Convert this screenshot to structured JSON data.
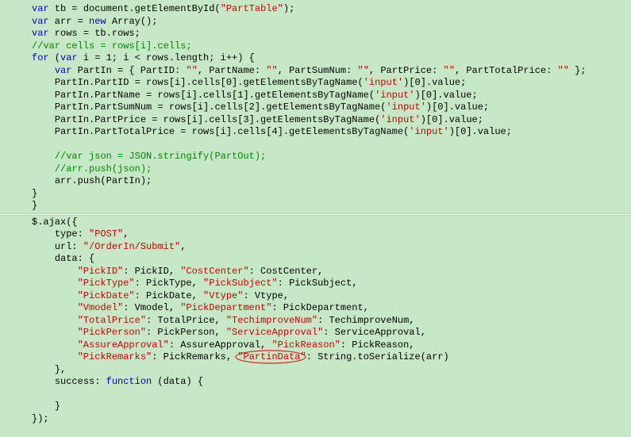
{
  "code_lines": [
    {
      "indent": 0,
      "segments": [
        {
          "t": "kw",
          "v": "var"
        },
        {
          "t": "",
          "v": " tb = document.getElementById("
        },
        {
          "t": "str",
          "v": "\"PartTable\""
        },
        {
          "t": "",
          "v": ");"
        }
      ]
    },
    {
      "indent": 0,
      "segments": [
        {
          "t": "kw",
          "v": "var"
        },
        {
          "t": "",
          "v": " arr = "
        },
        {
          "t": "kw",
          "v": "new"
        },
        {
          "t": "",
          "v": " Array();"
        }
      ]
    },
    {
      "indent": 0,
      "segments": [
        {
          "t": "kw",
          "v": "var"
        },
        {
          "t": "",
          "v": " rows = tb.rows;"
        }
      ]
    },
    {
      "indent": 0,
      "segments": [
        {
          "t": "cmt",
          "v": "//var cells = rows[i].cells;"
        }
      ]
    },
    {
      "indent": 0,
      "segments": [
        {
          "t": "kw",
          "v": "for"
        },
        {
          "t": "",
          "v": " ("
        },
        {
          "t": "kw",
          "v": "var"
        },
        {
          "t": "",
          "v": " i = 1; i < rows.length; i++) {"
        }
      ]
    },
    {
      "indent": 1,
      "segments": [
        {
          "t": "kw",
          "v": "var"
        },
        {
          "t": "",
          "v": " PartIn = { PartID: "
        },
        {
          "t": "str",
          "v": "\"\""
        },
        {
          "t": "",
          "v": ", PartName: "
        },
        {
          "t": "str",
          "v": "\"\""
        },
        {
          "t": "",
          "v": ", PartSumNum: "
        },
        {
          "t": "str",
          "v": "\"\""
        },
        {
          "t": "",
          "v": ", PartPrice: "
        },
        {
          "t": "str",
          "v": "\"\""
        },
        {
          "t": "",
          "v": ", PartTotalPrice: "
        },
        {
          "t": "str",
          "v": "\"\""
        },
        {
          "t": "",
          "v": " };"
        }
      ]
    },
    {
      "indent": 1,
      "segments": [
        {
          "t": "",
          "v": "PartIn.PartID = rows[i].cells[0].getElementsByTagName("
        },
        {
          "t": "str",
          "v": "'input'"
        },
        {
          "t": "",
          "v": ")[0].value;"
        }
      ]
    },
    {
      "indent": 1,
      "segments": [
        {
          "t": "",
          "v": "PartIn.PartName = rows[i].cells[1].getElementsByTagName("
        },
        {
          "t": "str",
          "v": "'input'"
        },
        {
          "t": "",
          "v": ")[0].value;"
        }
      ]
    },
    {
      "indent": 1,
      "segments": [
        {
          "t": "",
          "v": "PartIn.PartSumNum = rows[i].cells[2].getElementsByTagName("
        },
        {
          "t": "str",
          "v": "'input'"
        },
        {
          "t": "",
          "v": ")[0].value;"
        }
      ]
    },
    {
      "indent": 1,
      "segments": [
        {
          "t": "",
          "v": "PartIn.PartPrice = rows[i].cells[3].getElementsByTagName("
        },
        {
          "t": "str",
          "v": "'input'"
        },
        {
          "t": "",
          "v": ")[0].value;"
        }
      ]
    },
    {
      "indent": 1,
      "segments": [
        {
          "t": "",
          "v": "PartIn.PartTotalPrice = rows[i].cells[4].getElementsByTagName("
        },
        {
          "t": "str",
          "v": "'input'"
        },
        {
          "t": "",
          "v": ")[0].value;"
        }
      ]
    },
    {
      "indent": 1,
      "segments": [
        {
          "t": "",
          "v": ""
        }
      ]
    },
    {
      "indent": 1,
      "segments": [
        {
          "t": "cmt",
          "v": "//var json = JSON.stringify(PartOut);"
        }
      ]
    },
    {
      "indent": 1,
      "segments": [
        {
          "t": "cmt",
          "v": "//arr.push(json);"
        }
      ]
    },
    {
      "indent": 1,
      "segments": [
        {
          "t": "",
          "v": "arr.push(PartIn);"
        }
      ]
    },
    {
      "indent": 0,
      "segments": [
        {
          "t": "",
          "v": "}"
        }
      ]
    },
    {
      "indent": 0,
      "segments": [
        {
          "t": "",
          "v": "}"
        }
      ]
    },
    {
      "indent": 0,
      "gap": true
    },
    {
      "indent": 0,
      "segments": [
        {
          "t": "",
          "v": "$.ajax({"
        }
      ]
    },
    {
      "indent": 1,
      "segments": [
        {
          "t": "",
          "v": "type: "
        },
        {
          "t": "str",
          "v": "\"POST\""
        },
        {
          "t": "",
          "v": ","
        }
      ]
    },
    {
      "indent": 1,
      "segments": [
        {
          "t": "",
          "v": "url: "
        },
        {
          "t": "str",
          "v": "\"/OrderIn/Submit\""
        },
        {
          "t": "",
          "v": ","
        }
      ]
    },
    {
      "indent": 1,
      "segments": [
        {
          "t": "",
          "v": "data: {"
        }
      ]
    },
    {
      "indent": 2,
      "segments": [
        {
          "t": "str",
          "v": "\"PickID\""
        },
        {
          "t": "",
          "v": ": PickID, "
        },
        {
          "t": "str",
          "v": "\"CostCenter\""
        },
        {
          "t": "",
          "v": ": CostCenter,"
        }
      ]
    },
    {
      "indent": 2,
      "segments": [
        {
          "t": "str",
          "v": "\"PickType\""
        },
        {
          "t": "",
          "v": ": PickType, "
        },
        {
          "t": "str",
          "v": "\"PickSubject\""
        },
        {
          "t": "",
          "v": ": PickSubject,"
        }
      ]
    },
    {
      "indent": 2,
      "segments": [
        {
          "t": "str",
          "v": "\"PickDate\""
        },
        {
          "t": "",
          "v": ": PickDate, "
        },
        {
          "t": "str",
          "v": "\"Vtype\""
        },
        {
          "t": "",
          "v": ": Vtype,"
        }
      ]
    },
    {
      "indent": 2,
      "segments": [
        {
          "t": "str",
          "v": "\"Vmodel\""
        },
        {
          "t": "",
          "v": ": Vmodel, "
        },
        {
          "t": "str",
          "v": "\"PickDepartment\""
        },
        {
          "t": "",
          "v": ": PickDepartment,"
        }
      ]
    },
    {
      "indent": 2,
      "segments": [
        {
          "t": "str",
          "v": "\"TotalPrice\""
        },
        {
          "t": "",
          "v": ": TotalPrice, "
        },
        {
          "t": "str",
          "v": "\"TechimproveNum\""
        },
        {
          "t": "",
          "v": ": TechimproveNum,"
        }
      ]
    },
    {
      "indent": 2,
      "segments": [
        {
          "t": "str",
          "v": "\"PickPerson\""
        },
        {
          "t": "",
          "v": ": PickPerson, "
        },
        {
          "t": "str",
          "v": "\"ServiceApproval\""
        },
        {
          "t": "",
          "v": ": ServiceApproval,"
        }
      ]
    },
    {
      "indent": 2,
      "segments": [
        {
          "t": "str",
          "v": "\"AssureApproval\""
        },
        {
          "t": "",
          "v": ": AssureApproval, "
        },
        {
          "t": "str",
          "v": "\"PickReason\""
        },
        {
          "t": "",
          "v": ": PickReason,"
        }
      ]
    },
    {
      "indent": 2,
      "circled": true,
      "segments": [
        {
          "t": "str",
          "v": "\"PickRemarks\""
        },
        {
          "t": "",
          "v": ": PickRemarks, "
        },
        {
          "t": "circled",
          "v": "\"PartinData\""
        },
        {
          "t": "",
          "v": ": String.toSerialize(arr)"
        }
      ]
    },
    {
      "indent": 1,
      "segments": [
        {
          "t": "",
          "v": "},"
        }
      ]
    },
    {
      "indent": 1,
      "segments": [
        {
          "t": "",
          "v": "success: "
        },
        {
          "t": "kw",
          "v": "function"
        },
        {
          "t": "",
          "v": " (data) {"
        }
      ]
    },
    {
      "indent": 1,
      "segments": [
        {
          "t": "",
          "v": ""
        }
      ]
    },
    {
      "indent": 1,
      "segments": [
        {
          "t": "",
          "v": "}"
        }
      ]
    },
    {
      "indent": 0,
      "segments": [
        {
          "t": "",
          "v": "});"
        }
      ]
    }
  ],
  "indent_unit": "    ",
  "circle_color": "#dd2222"
}
